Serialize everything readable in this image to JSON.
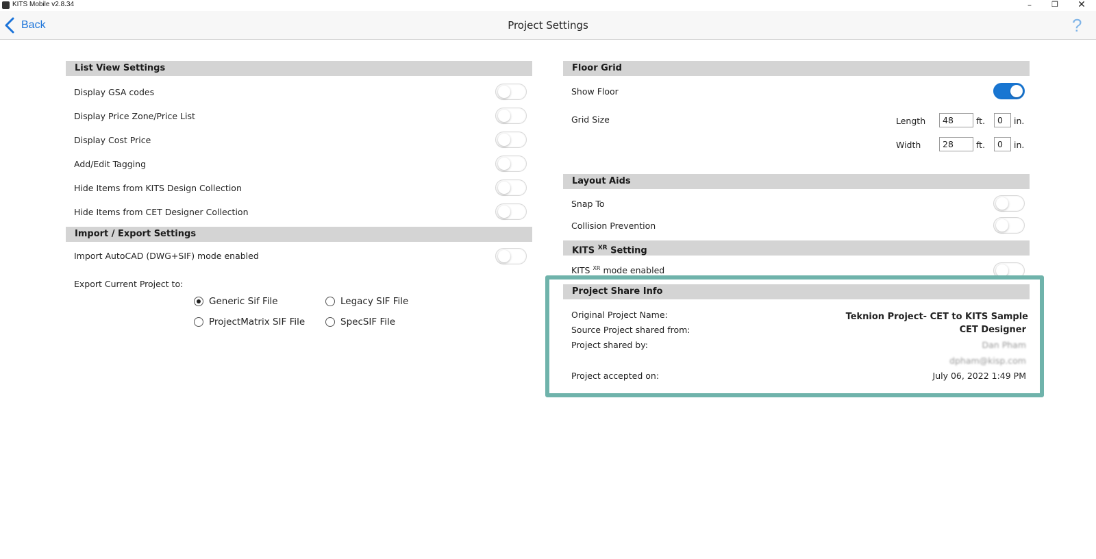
{
  "window": {
    "title": "KITS Mobile v2.8.34",
    "minimize": "–",
    "maximize": "❐",
    "close": "✕"
  },
  "nav": {
    "back_label": "Back",
    "page_title": "Project Settings",
    "help": "?"
  },
  "list_view": {
    "header": "List View Settings",
    "items": [
      {
        "label": "Display GSA codes",
        "on": false
      },
      {
        "label": "Display Price Zone/Price List",
        "on": false
      },
      {
        "label": "Display Cost Price",
        "on": false
      },
      {
        "label": "Add/Edit Tagging",
        "on": false
      },
      {
        "label": "Hide Items from KITS Design Collection",
        "on": false
      },
      {
        "label": "Hide Items from CET Designer Collection",
        "on": false
      }
    ]
  },
  "import_export": {
    "header": "Import / Export Settings",
    "autocad_label": "Import AutoCAD (DWG+SIF) mode enabled",
    "autocad_on": false,
    "export_label": "Export Current Project to:",
    "options": [
      {
        "label": "Generic Sif File",
        "selected": true
      },
      {
        "label": "Legacy SIF File",
        "selected": false
      },
      {
        "label": "ProjectMatrix SIF File",
        "selected": false
      },
      {
        "label": "SpecSIF File",
        "selected": false
      }
    ]
  },
  "floor_grid": {
    "header": "Floor Grid",
    "show_floor_label": "Show Floor",
    "show_floor_on": true,
    "grid_size_label": "Grid Size",
    "length_label": "Length",
    "length_ft": "48",
    "length_in": "0",
    "width_label": "Width",
    "width_ft": "28",
    "width_in": "0",
    "ft_unit": "ft.",
    "in_unit": "in."
  },
  "layout_aids": {
    "header": "Layout Aids",
    "snap_label": "Snap To",
    "snap_on": false,
    "collision_label": "Collision Prevention",
    "collision_on": false
  },
  "xr": {
    "header_prefix": "KITS",
    "header_sup": "XR",
    "header_suffix": "Setting",
    "mode_prefix": "KITS",
    "mode_sup": "XR",
    "mode_suffix": "mode enabled",
    "mode_on": false
  },
  "share_info": {
    "header": "Project Share Info",
    "original_name_label": "Original Project Name:",
    "original_name_value": "Teknion Project- CET to KITS Sample",
    "source_label": "Source Project shared from:",
    "source_value": "CET Designer",
    "shared_by_label": "Project shared by:",
    "shared_by_name": "Dan Pham",
    "shared_by_email": "dpham@kisp.com",
    "accepted_label": "Project accepted on:",
    "accepted_value": "July 06, 2022 1:49 PM"
  },
  "colors": {
    "accent_blue": "#1976d2",
    "highlight_border": "#6fb3ab",
    "section_header_bg": "#d4d4d4"
  }
}
